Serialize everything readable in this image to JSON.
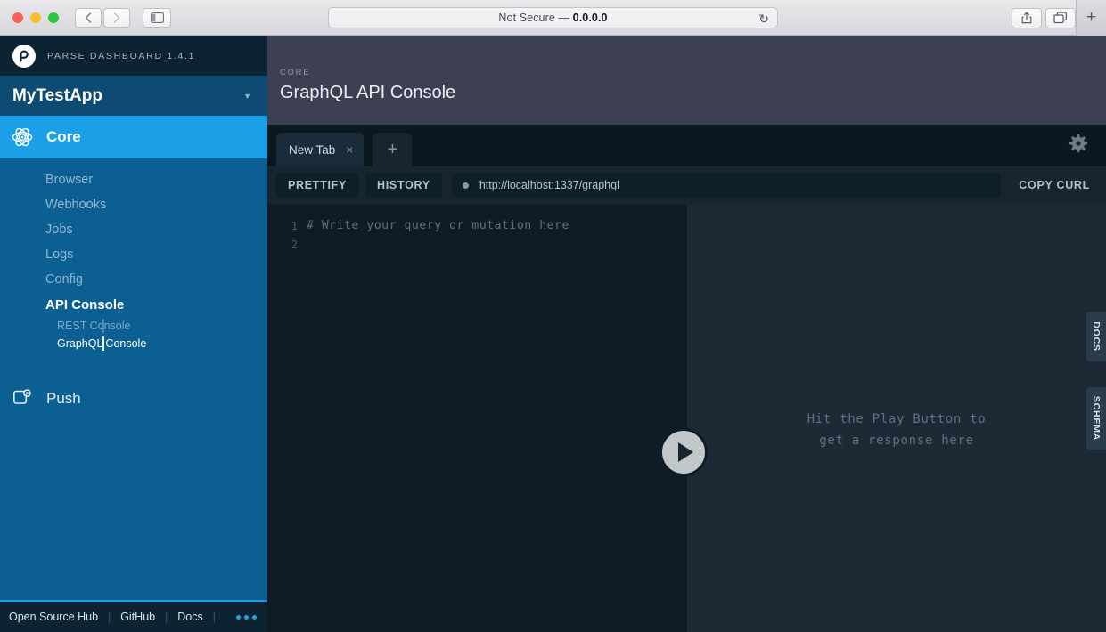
{
  "browser": {
    "back_icon": "chevron-left-icon",
    "forward_icon": "chevron-right-icon",
    "sidebar_icon": "sidebar-toggle-icon",
    "address_prefix": "Not Secure — ",
    "address_value": "0.0.0.0",
    "reload_icon": "↻",
    "share_icon": "share-icon",
    "tabs_icon": "tabs-overview-icon",
    "new_tab_icon": "+"
  },
  "sidebar": {
    "brand": "PARSE DASHBOARD 1.4.1",
    "app_name": "MyTestApp",
    "app_chevron": "▼",
    "core_label": "Core",
    "nav_items": [
      {
        "label": "Browser",
        "active": false
      },
      {
        "label": "Webhooks",
        "active": false
      },
      {
        "label": "Jobs",
        "active": false
      },
      {
        "label": "Logs",
        "active": false
      },
      {
        "label": "Config",
        "active": false
      },
      {
        "label": "API Console",
        "active": true
      }
    ],
    "sub_items": [
      {
        "label": "REST Console",
        "active": false
      },
      {
        "label": "GraphQL Console",
        "active": true
      }
    ],
    "push_label": "Push",
    "footer": {
      "links": [
        "Open Source Hub",
        "GitHub",
        "Docs"
      ],
      "separator": "|"
    }
  },
  "header": {
    "eyebrow": "CORE",
    "title": "GraphQL API Console"
  },
  "graphiql": {
    "tab_label": "New Tab",
    "tab_close": "×",
    "add_tab": "+",
    "settings_icon": "gear-icon",
    "prettify_label": "PRETTIFY",
    "history_label": "HISTORY",
    "copy_curl_label": "COPY CURL",
    "url": "http://localhost:1337/graphql",
    "editor": {
      "lines": [
        {
          "number": "1",
          "text": "# Write your query or mutation here"
        },
        {
          "number": "2",
          "text": ""
        }
      ]
    },
    "play_button": "play-icon",
    "response_placeholder_line1": "Hit the Play Button to",
    "response_placeholder_line2": "get a response here",
    "side_tabs": [
      "DOCS",
      "SCHEMA"
    ]
  },
  "colors": {
    "accent_blue": "#1ba0e8",
    "sidebar_blue": "#0c5f93",
    "dark_navy": "#0c2432",
    "header_purple": "#3d3f53",
    "editor_bg": "#0f1c26",
    "response_bg": "#1d2a35"
  }
}
